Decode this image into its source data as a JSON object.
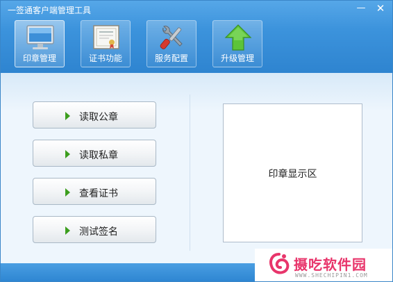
{
  "window": {
    "title": "一签通客户端管理工具",
    "minimize_symbol": "—",
    "close_symbol": "✕"
  },
  "toolbar": {
    "items": [
      {
        "label": "印章管理",
        "icon": "monitor-icon",
        "active": true
      },
      {
        "label": "证书功能",
        "icon": "certificate-icon",
        "active": false
      },
      {
        "label": "服务配置",
        "icon": "tools-icon",
        "active": false
      },
      {
        "label": "升级管理",
        "icon": "upgrade-arrow-icon",
        "active": false
      }
    ]
  },
  "actions": {
    "buttons": [
      {
        "label": "读取公章"
      },
      {
        "label": "读取私章"
      },
      {
        "label": "查看证书"
      },
      {
        "label": "测试签名"
      }
    ]
  },
  "display": {
    "label": "印章显示区"
  },
  "watermark": {
    "brand": "摄吃软件园",
    "url": "WWW.SHECHIPIN1.COM"
  },
  "colors": {
    "header": "#3c93dc",
    "accent_arrow": "#3c9e1e",
    "watermark": "#e8356b"
  }
}
